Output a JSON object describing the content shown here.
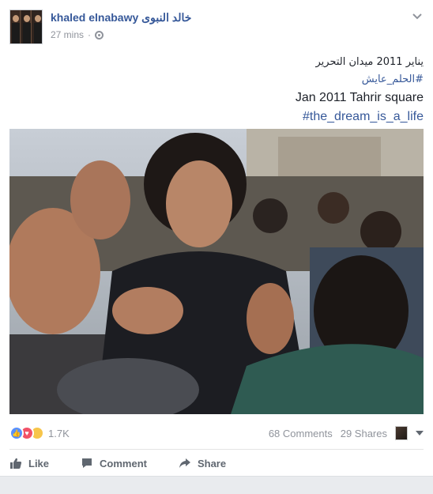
{
  "post": {
    "author": "khaled elnabawy خالد النبوى",
    "time": "27 mins",
    "privacy_icon": "globe-icon",
    "lines": [
      "يناير 2011 ميدان التحرير",
      "#الحلم_عايش",
      "Jan 2011 Tahrir square",
      "#the_dream_is_a_life"
    ]
  },
  "stats": {
    "reaction_icons": [
      "like-reaction-icon",
      "love-reaction-icon",
      "sad-reaction-icon"
    ],
    "reaction_count": "1.7K",
    "comments": "68 Comments",
    "shares": "29 Shares"
  },
  "actions": {
    "like": "Like",
    "comment": "Comment",
    "share": "Share"
  },
  "colors": {
    "link": "#365899",
    "muted": "#90949c",
    "action": "#606770"
  }
}
